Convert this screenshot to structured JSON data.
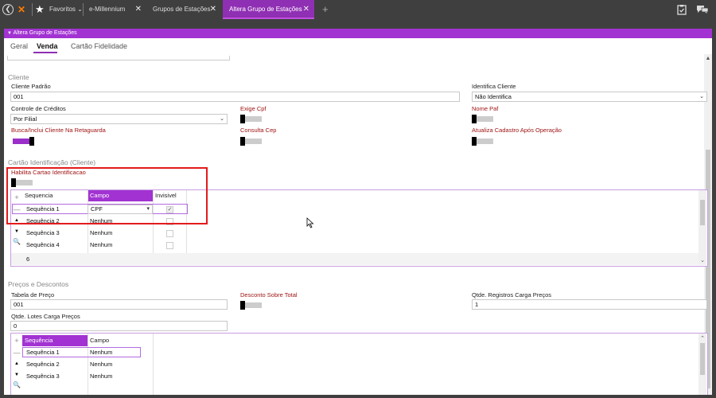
{
  "topbar": {
    "back_icon": "back-arrow-icon",
    "logo_icon": "millennium-logo-icon",
    "favorites_label": "Favoritos",
    "favorites_chevron": "⌄",
    "tabs": [
      {
        "label": "e-Millennium",
        "close": "✕",
        "active": false
      },
      {
        "label": "Grupos de Estações",
        "close": "✕",
        "active": false
      },
      {
        "label": "Altera Grupo de Estações",
        "close": "✕",
        "active": true
      }
    ],
    "add_tab": "+",
    "clipboard_icon": "clipboard-check-icon",
    "chat_icon": "chat-bubbles-icon"
  },
  "header": {
    "title": "Altera Grupo de Estações",
    "collapse_glyph": "▼"
  },
  "subtabs": [
    "Geral",
    "Venda",
    "Cartão Fidelidade"
  ],
  "cliente": {
    "section_title": "Cliente",
    "cliente_padrao_label": "Cliente Padrão",
    "cliente_padrao_value": "001",
    "identifica_cliente_label": "Identifica Cliente",
    "identifica_cliente_value": "Não Identifica",
    "controle_creditos_label": "Controle de Créditos",
    "controle_creditos_value": "Por Filial",
    "exige_cpf_label": "Exige Cpf",
    "nome_paf_label": "Nome Paf",
    "busca_label": "Busca/Inclui Cliente Na Retaguarda",
    "consulta_cep_label": "Consulta Cep",
    "atualiza_label": "Atualiza Cadastro Após Operação",
    "toggles": {
      "exige_cpf": false,
      "nome_paf": false,
      "busca": true,
      "consulta_cep": false,
      "atualiza": false
    }
  },
  "cartao": {
    "section_title": "Cartão Identificação (Cliente)",
    "habilita_label": "Habilita Cartao Identificacao",
    "habilita_on": false,
    "grid": {
      "headers": [
        "Sequencia",
        "Campo",
        "Invisivel"
      ],
      "rows": [
        {
          "sequencia": "Sequência 1",
          "campo": "CPF",
          "invisivel": true
        },
        {
          "sequencia": "Sequência 2",
          "campo": "Nenhum",
          "invisivel": false
        },
        {
          "sequencia": "Sequência 3",
          "campo": "Nenhum",
          "invisivel": false
        },
        {
          "sequencia": "Sequência 4",
          "campo": "Nenhum",
          "invisivel": false
        }
      ],
      "footer_count": "6"
    },
    "row_icons": [
      "+",
      "—",
      "▲",
      "▼",
      "🔍"
    ]
  },
  "precos": {
    "section_title": "Preços e Descontos",
    "tabela_label": "Tabela de Preço",
    "tabela_value": "001",
    "desconto_label": "Desconto Sobre Total",
    "qtde_registros_label": "Qtde. Registros Carga Preços",
    "qtde_registros_value": "1",
    "qtde_lotes_label": "Qtde. Lotes Carga Preços",
    "qtde_lotes_value": "0",
    "desconto_on": false,
    "grid": {
      "headers": [
        "Sequência",
        "Campo"
      ],
      "rows": [
        {
          "sequencia": "Sequência 1",
          "campo": "Nenhum"
        },
        {
          "sequencia": "Sequência 2",
          "campo": "Nenhum"
        },
        {
          "sequencia": "Sequência 3",
          "campo": "Nenhum"
        }
      ]
    }
  },
  "colors": {
    "accent": "#a233d2",
    "dark": "#3f3f3f",
    "required_label": "#a01414",
    "highlight_box": "#e31b1b"
  }
}
